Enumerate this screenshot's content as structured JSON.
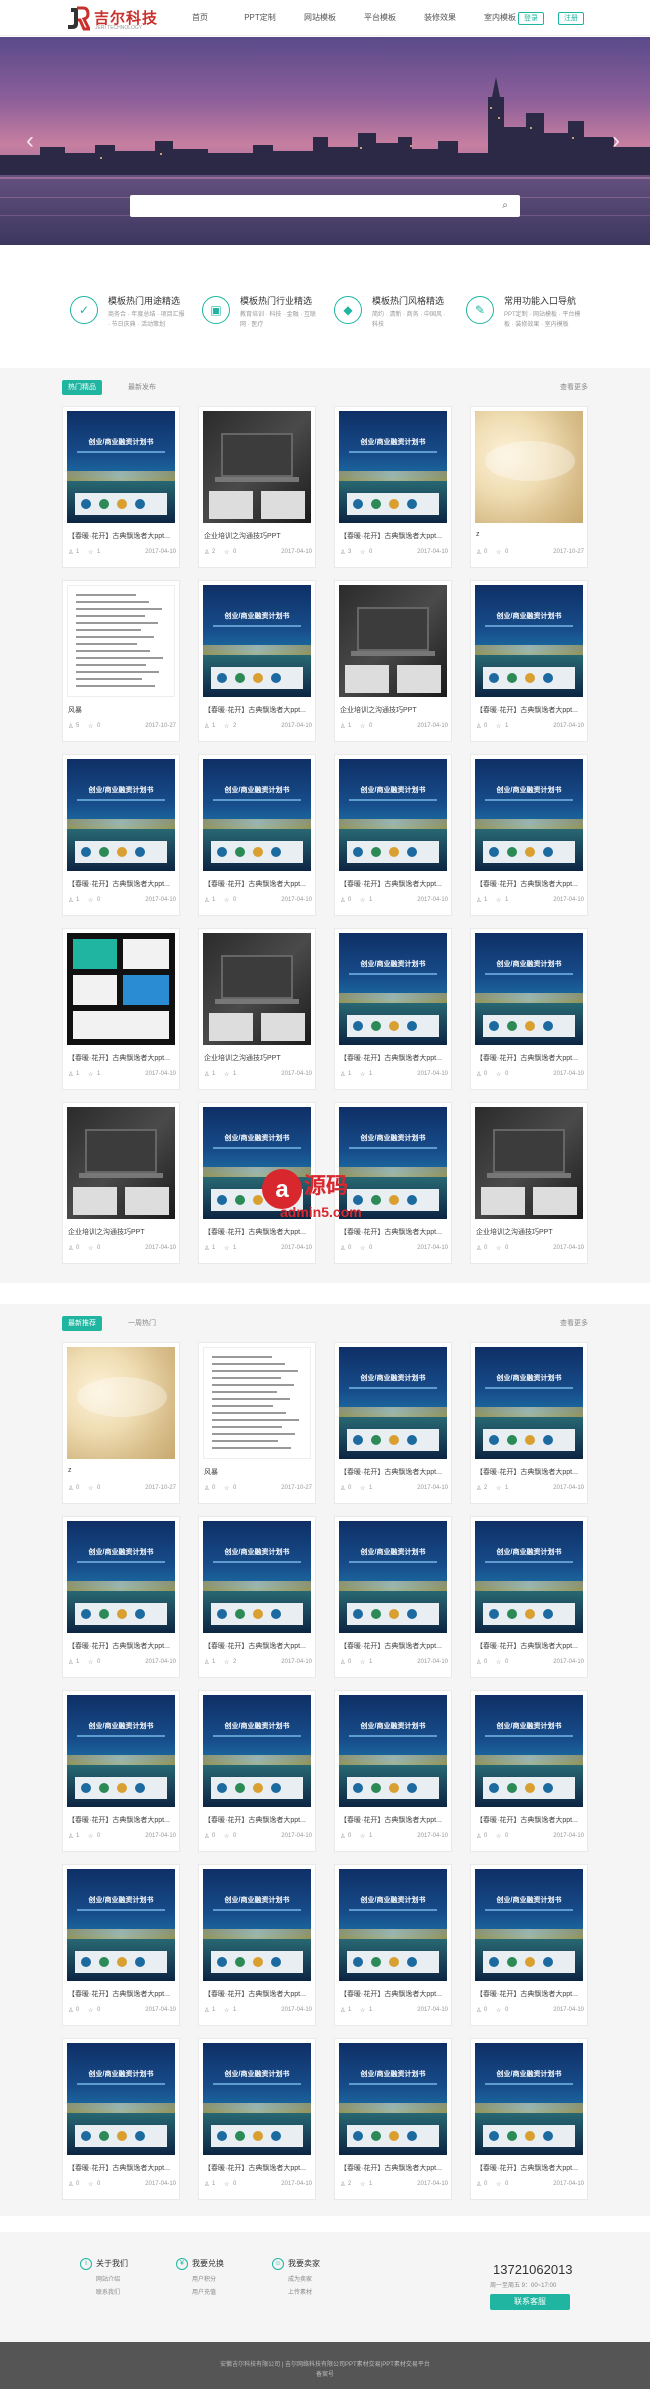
{
  "header": {
    "logo_text": "吉尔科技",
    "logo_sub": "JERI TECHNOLOGY",
    "nav": [
      "首页",
      "PPT定制",
      "网站模板",
      "平台模板",
      "装修效果",
      "室内模板"
    ],
    "login_label": "登录",
    "register_label": "注册"
  },
  "banner": {
    "search_placeholder": "",
    "slide_count": 5,
    "active_slide": 4
  },
  "features": [
    {
      "title": "模板热门用途精选",
      "links": "商务合 · 年度总结 · 项目汇报 · 节日庆典 · 活动策划"
    },
    {
      "title": "模板热门行业精选",
      "links": "教育培训 · 科技 · 金融 · 互联网 · 医疗"
    },
    {
      "title": "模板热门风格精选",
      "links": "简约 · 清新 · 商务 · 中国风 · 科技"
    },
    {
      "title": "常用功能入口导航",
      "links": "PPT定制 · 网站模板 · 平台模板 · 装修效果 · 室内模板"
    }
  ],
  "section1": {
    "tab_active": "热门精品",
    "tab_other": "最新发布",
    "more": "查看更多",
    "cards": [
      {
        "type": "ppt",
        "title": "【春暖·花开】古典飘逸者大ppt...",
        "a": "1",
        "b": "1",
        "date": "2017-04-10"
      },
      {
        "type": "dark",
        "title": "企业培训之沟通技巧PPT",
        "a": "2",
        "b": "0",
        "date": "2017-04-10"
      },
      {
        "type": "ppt",
        "title": "【春暖·花开】古典飘逸者大ppt...",
        "a": "3",
        "b": "0",
        "date": "2017-04-10"
      },
      {
        "type": "marble",
        "title": "z",
        "a": "0",
        "b": "0",
        "date": "2017-10-27"
      },
      {
        "type": "doc",
        "title": "风暴",
        "a": "5",
        "b": "0",
        "date": "2017-10-27"
      },
      {
        "type": "ppt",
        "title": "【春暖·花开】古典飘逸者大ppt...",
        "a": "1",
        "b": "2",
        "date": "2017-04-10"
      },
      {
        "type": "dark",
        "title": "企业培训之沟通技巧PPT",
        "a": "1",
        "b": "0",
        "date": "2017-04-10"
      },
      {
        "type": "ppt",
        "title": "【春暖·花开】古典飘逸者大ppt...",
        "a": "0",
        "b": "1",
        "date": "2017-04-10"
      },
      {
        "type": "ppt",
        "title": "【春暖·花开】古典飘逸者大ppt...",
        "a": "1",
        "b": "0",
        "date": "2017-04-10"
      },
      {
        "type": "ppt",
        "title": "【春暖·花开】古典飘逸者大ppt...",
        "a": "1",
        "b": "0",
        "date": "2017-04-10"
      },
      {
        "type": "ppt",
        "title": "【春暖·花开】古典飘逸者大ppt...",
        "a": "0",
        "b": "1",
        "date": "2017-04-10"
      },
      {
        "type": "ppt",
        "title": "【春暖·花开】古典飘逸者大ppt...",
        "a": "1",
        "b": "1",
        "date": "2017-04-10"
      },
      {
        "type": "black",
        "title": "【春暖·花开】古典飘逸者大ppt...",
        "a": "1",
        "b": "1",
        "date": "2017-04-10"
      },
      {
        "type": "dark",
        "title": "企业培训之沟通技巧PPT",
        "a": "1",
        "b": "1",
        "date": "2017-04-10"
      },
      {
        "type": "ppt",
        "title": "【春暖·花开】古典飘逸者大ppt...",
        "a": "1",
        "b": "1",
        "date": "2017-04-10"
      },
      {
        "type": "ppt",
        "title": "【春暖·花开】古典飘逸者大ppt...",
        "a": "0",
        "b": "0",
        "date": "2017-04-10"
      },
      {
        "type": "dark",
        "title": "企业培训之沟通技巧PPT",
        "a": "0",
        "b": "0",
        "date": "2017-04-10"
      },
      {
        "type": "ppt",
        "title": "【春暖·花开】古典飘逸者大ppt...",
        "a": "1",
        "b": "1",
        "date": "2017-04-10"
      },
      {
        "type": "ppt",
        "title": "【春暖·花开】古典飘逸者大ppt...",
        "a": "0",
        "b": "0",
        "date": "2017-04-10"
      },
      {
        "type": "dark",
        "title": "企业培训之沟通技巧PPT",
        "a": "0",
        "b": "0",
        "date": "2017-04-10"
      }
    ]
  },
  "section2": {
    "tab_active": "最新推荐",
    "tab_other": "一周热门",
    "more": "查看更多",
    "cards": [
      {
        "type": "marble",
        "title": "z",
        "a": "0",
        "b": "0",
        "date": "2017-10-27"
      },
      {
        "type": "doc",
        "title": "风暴",
        "a": "0",
        "b": "0",
        "date": "2017-10-27"
      },
      {
        "type": "ppt",
        "title": "【春暖·花开】古典飘逸者大ppt...",
        "a": "0",
        "b": "1",
        "date": "2017-04-10"
      },
      {
        "type": "ppt",
        "title": "【春暖·花开】古典飘逸者大ppt...",
        "a": "2",
        "b": "1",
        "date": "2017-04-10"
      },
      {
        "type": "ppt",
        "title": "【春暖·花开】古典飘逸者大ppt...",
        "a": "1",
        "b": "0",
        "date": "2017-04-10"
      },
      {
        "type": "ppt",
        "title": "【春暖·花开】古典飘逸者大ppt...",
        "a": "1",
        "b": "2",
        "date": "2017-04-10"
      },
      {
        "type": "ppt",
        "title": "【春暖·花开】古典飘逸者大ppt...",
        "a": "0",
        "b": "1",
        "date": "2017-04-10"
      },
      {
        "type": "ppt",
        "title": "【春暖·花开】古典飘逸者大ppt...",
        "a": "0",
        "b": "0",
        "date": "2017-04-10"
      },
      {
        "type": "ppt",
        "title": "【春暖·花开】古典飘逸者大ppt...",
        "a": "1",
        "b": "0",
        "date": "2017-04-10"
      },
      {
        "type": "ppt",
        "title": "【春暖·花开】古典飘逸者大ppt...",
        "a": "0",
        "b": "0",
        "date": "2017-04-10"
      },
      {
        "type": "ppt",
        "title": "【春暖·花开】古典飘逸者大ppt...",
        "a": "0",
        "b": "1",
        "date": "2017-04-10"
      },
      {
        "type": "ppt",
        "title": "【春暖·花开】古典飘逸者大ppt...",
        "a": "0",
        "b": "0",
        "date": "2017-04-10"
      },
      {
        "type": "ppt",
        "title": "【春暖·花开】古典飘逸者大ppt...",
        "a": "0",
        "b": "0",
        "date": "2017-04-10"
      },
      {
        "type": "ppt",
        "title": "【春暖·花开】古典飘逸者大ppt...",
        "a": "1",
        "b": "1",
        "date": "2017-04-10"
      },
      {
        "type": "ppt",
        "title": "【春暖·花开】古典飘逸者大ppt...",
        "a": "1",
        "b": "1",
        "date": "2017-04-10"
      },
      {
        "type": "ppt",
        "title": "【春暖·花开】古典飘逸者大ppt...",
        "a": "0",
        "b": "0",
        "date": "2017-04-10"
      },
      {
        "type": "ppt",
        "title": "【春暖·花开】古典飘逸者大ppt...",
        "a": "0",
        "b": "0",
        "date": "2017-04-10"
      },
      {
        "type": "ppt",
        "title": "【春暖·花开】古典飘逸者大ppt...",
        "a": "1",
        "b": "0",
        "date": "2017-04-10"
      },
      {
        "type": "ppt",
        "title": "【春暖·花开】古典飘逸者大ppt...",
        "a": "2",
        "b": "1",
        "date": "2017-04-10"
      },
      {
        "type": "ppt",
        "title": "【春暖·花开】古典飘逸者大ppt...",
        "a": "0",
        "b": "0",
        "date": "2017-04-10"
      }
    ]
  },
  "footer": {
    "col1": {
      "title": "关于我们",
      "links": [
        "网站介绍",
        "联系我们"
      ]
    },
    "col2": {
      "title": "我要兑换",
      "links": [
        "用户积分",
        "用户充值"
      ]
    },
    "col3": {
      "title": "我要卖家",
      "links": [
        "成为卖家",
        "上传素材"
      ]
    },
    "phone": "13721062013",
    "hours": "周一至周五 9：00~17:00",
    "contact_btn": "联系客服",
    "copyright_line1": "安徽吉尔科技有限公司 | 吉尔网络科技有限公司PPT素材交易|PPT素材交易平台",
    "copyright_line2": "备案号"
  },
  "watermark": {
    "text1": "源码",
    "text2": "admin5.com"
  },
  "colors": {
    "accent": "#1fb5a0",
    "logo_red": "#c9302c"
  }
}
